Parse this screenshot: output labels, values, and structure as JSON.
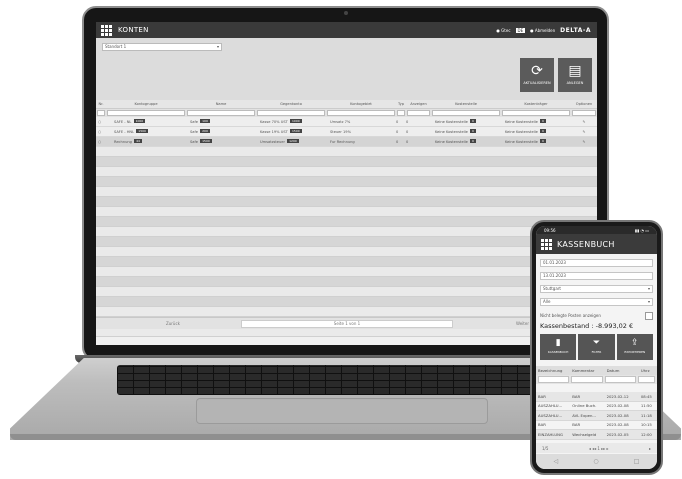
{
  "laptop": {
    "app": {
      "title": "KONTEN",
      "header_right": {
        "user": "● Gtec",
        "lang": "DE",
        "status": "● Abmelden",
        "logo": "DELTA-A"
      }
    },
    "toolbar": {
      "branch": "Standort 1",
      "buttons": [
        {
          "label": "AKTUALISIEREN",
          "icon": "refresh-icon"
        },
        {
          "label": "ANLEGEN",
          "icon": "new-doc-icon"
        }
      ]
    },
    "table": {
      "columns": [
        "Nr.",
        "Kontogruppe",
        "Name",
        "Gegenkonto",
        "Kontogebiet",
        "Typ",
        "Anzeigen",
        "Kostenstelle",
        "Kostenträger",
        "Optionen"
      ],
      "rows": [
        {
          "nr": "",
          "group": "SAFE - NL",
          "group_tag": "1000",
          "name": "Safe",
          "name_tag": "100",
          "counter": "Kasse 70% UST",
          "counter_tag": "1000",
          "area": "Umsatz 7%",
          "typ": "0",
          "show": "0",
          "cost": "Keine Kostenstelle",
          "cost_tag": "0",
          "bearer": "Keine Kostenstelle",
          "bearer_tag": "0",
          "opt": "✎"
        },
        {
          "nr": "",
          "group": "SAFE - HNL",
          "group_tag": "1500",
          "name": "Safe",
          "name_tag": "200",
          "counter": "Kasse 19% UST",
          "counter_tag": "1500",
          "area": "Steuer 19%",
          "typ": "0",
          "show": "0",
          "cost": "Keine Kostenstelle",
          "cost_tag": "0",
          "bearer": "Keine Kostenstelle",
          "bearer_tag": "0",
          "opt": "✎"
        },
        {
          "nr": "",
          "group": "Rechnung",
          "group_tag": "44",
          "name": "Safe",
          "name_tag": "1500",
          "counter": "Umsatzsteuer",
          "counter_tag": "1200",
          "area": "Fur Rechnung",
          "typ": "0",
          "show": "0",
          "cost": "Keine Kostenstelle",
          "cost_tag": "0",
          "bearer": "Keine Kostenstelle",
          "bearer_tag": "0",
          "opt": "✎"
        }
      ]
    },
    "pager": {
      "left": "Zurück",
      "center": "Seite 1 von 1",
      "right": "Weiter"
    }
  },
  "phone": {
    "status_bar": {
      "time": "09:56",
      "icons": "▮▮ ◔ ▭"
    },
    "title": "KASSENBUCH",
    "fields": {
      "date_from": "01.01.2023",
      "date_to": "13.01.2023",
      "location": "Stuttgart",
      "filter": "Alle"
    },
    "checkbox_label": "Nicht belegte Posten anzeigen",
    "balance": "Kassenbestand : -8.993,02 €",
    "actions": [
      {
        "label": "KASSENBUCH",
        "icon": "book-icon"
      },
      {
        "label": "FILTER",
        "icon": "filter-icon"
      },
      {
        "label": "EXPORTIEREN",
        "icon": "export-icon"
      }
    ],
    "columns": [
      "Bezeichnung",
      "Kommentar",
      "Datum",
      "Uhrz"
    ],
    "rows": [
      {
        "a": "BAR",
        "b": "BAR",
        "c": "2023-02-12",
        "d": "08:45"
      },
      {
        "a": "AUSZAHLU...",
        "b": "Online Buch.",
        "c": "2023-02-08",
        "d": "11:50"
      },
      {
        "a": "AUSZAHLU...",
        "b": "AVL Expen...",
        "c": "2023-02-08",
        "d": "11:18"
      },
      {
        "a": "BAR",
        "b": "BAR",
        "c": "2023-02-08",
        "d": "10:15"
      },
      {
        "a": "EINZAHLUNG",
        "b": "Wechselgeld",
        "c": "2023-02-05",
        "d": "12:00"
      }
    ],
    "footer": {
      "left": "1/5",
      "center": "◂ ◂◂  1  ▸▸ ▸",
      "right": "▸"
    }
  }
}
